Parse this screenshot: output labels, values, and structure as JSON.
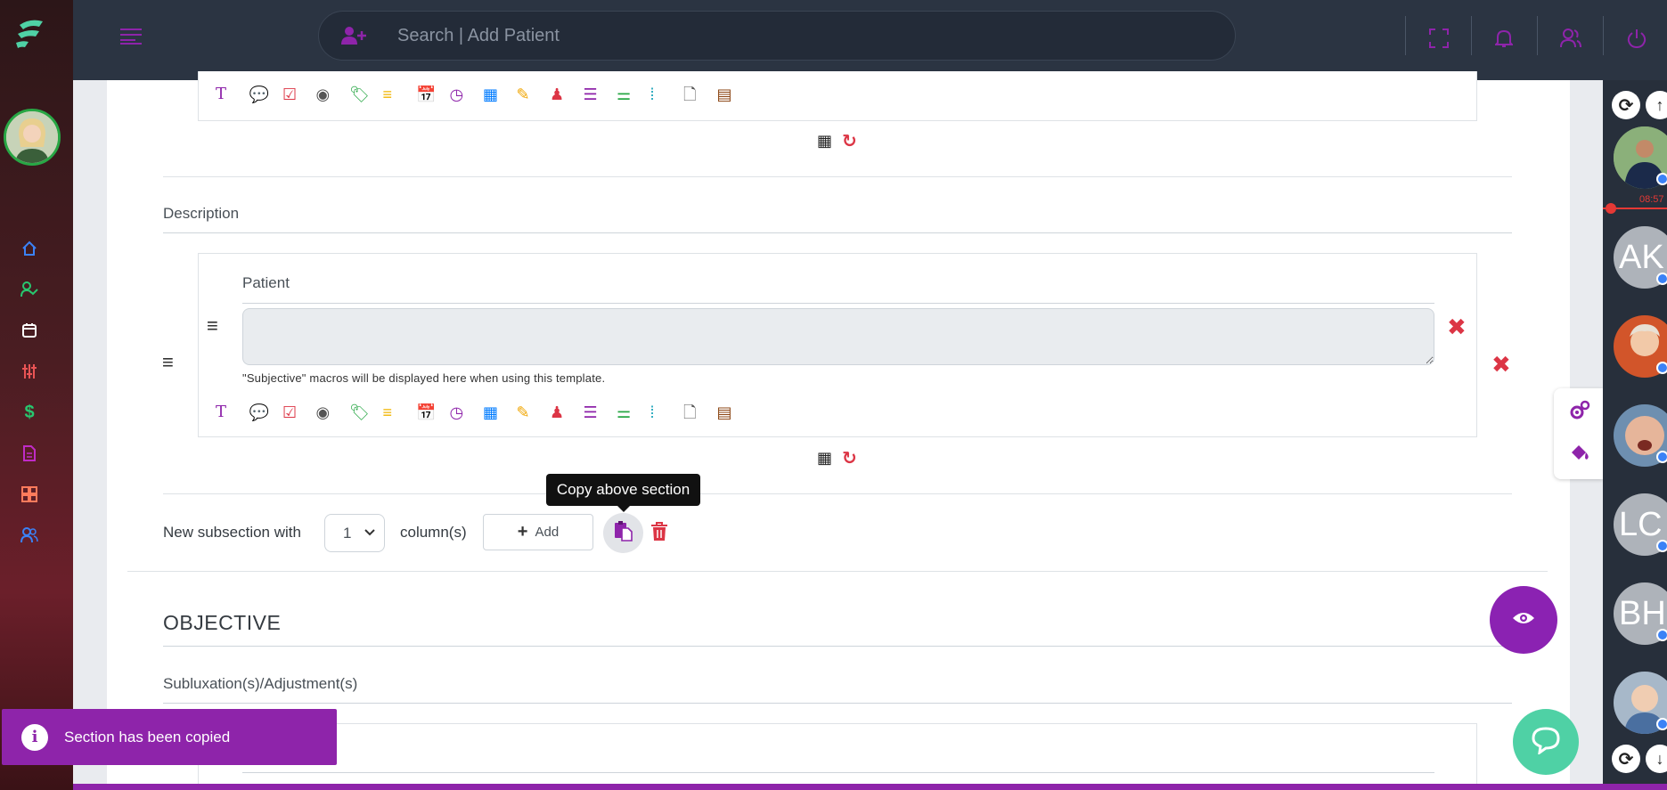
{
  "search": {
    "placeholder": "Search | Add Patient"
  },
  "subjective": {
    "description_label": "Description",
    "field_label": "Patient",
    "help_text": "\"Subjective\" macros will be displayed here when using this template."
  },
  "subsection": {
    "prefix": "New subsection with",
    "columns_value": "1",
    "columns_suffix": "column(s)",
    "add_label": "Add",
    "copy_tooltip": "Copy above section"
  },
  "objective": {
    "title": "OBJECTIVE",
    "subsection_label": "Subluxation(s)/Adjustment(s)"
  },
  "toast": {
    "message": "Section has been copied"
  },
  "right_panel": {
    "timer": "08:57",
    "users": [
      {
        "initials": "AK"
      },
      {
        "initials": "LC"
      },
      {
        "initials": "BH"
      }
    ]
  },
  "colors": {
    "accent": "#8e24aa",
    "danger": "#dc3545",
    "topbar": "#2b3442"
  }
}
